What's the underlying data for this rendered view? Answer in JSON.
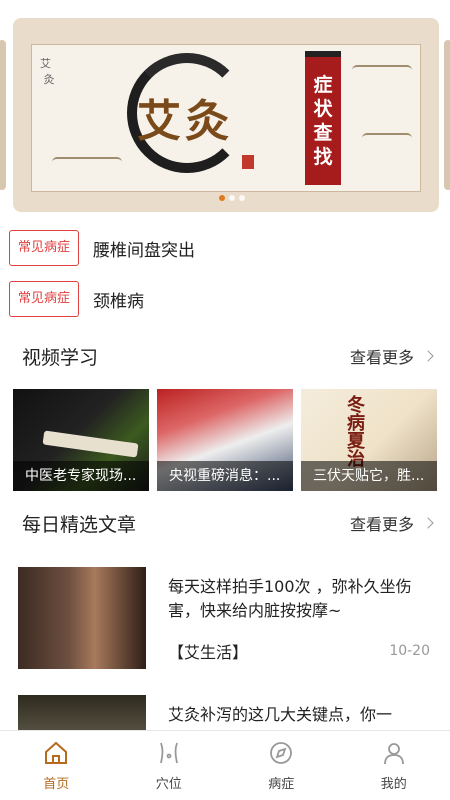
{
  "banner": {
    "brush_title": "艾灸",
    "tag_lines": [
      "症",
      "状",
      "查",
      "找"
    ]
  },
  "symptoms": [
    {
      "tag": "常见病症",
      "label": "腰椎间盘突出"
    },
    {
      "tag": "常见病症",
      "label": "颈椎病"
    }
  ],
  "video_section": {
    "title": "视频学习",
    "more": "查看更多",
    "items": [
      {
        "caption": "中医老专家现场..."
      },
      {
        "caption": "央视重磅消息：..."
      },
      {
        "caption": "三伏天贴它，胜..."
      }
    ]
  },
  "article_section": {
    "title": "每日精选文章",
    "more": "查看更多",
    "items": [
      {
        "title": "每天这样拍手100次 ，弥补久坐伤害，快来给内脏按按摩~",
        "source": "【艾生活】",
        "date": "10-20"
      },
      {
        "title": "艾灸补泻的这几大关键点，你一",
        "source": "",
        "date": ""
      }
    ]
  },
  "tabbar": {
    "items": [
      {
        "label": "首页",
        "icon": "home-icon",
        "active": true
      },
      {
        "label": "穴位",
        "icon": "body-icon",
        "active": false
      },
      {
        "label": "病症",
        "icon": "compass-icon",
        "active": false
      },
      {
        "label": "我的",
        "icon": "user-icon",
        "active": false
      }
    ],
    "active_color": "#b56a1e"
  }
}
